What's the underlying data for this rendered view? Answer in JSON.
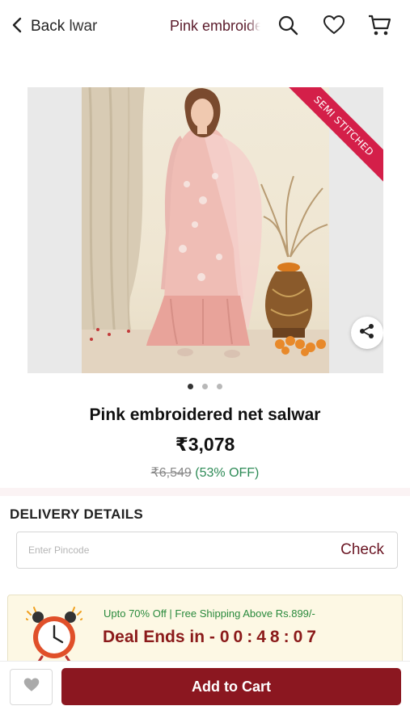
{
  "header": {
    "back_label": "Back",
    "back_overlap_text": "Pink embroidered net salwar",
    "title": "Pink embroidered net salwar",
    "icons": [
      "search-icon",
      "heart-icon",
      "cart-icon"
    ]
  },
  "gallery": {
    "badge": "SEMI STITCHED",
    "dots_count": 3,
    "active_dot": 0
  },
  "product": {
    "name": "Pink embroidered net salwar",
    "price": "₹3,078",
    "mrp": "₹6,549",
    "discount": "(53% OFF)"
  },
  "delivery": {
    "title": "DELIVERY DETAILS",
    "pincode_placeholder": "Enter Pincode",
    "check_label": "Check"
  },
  "deal": {
    "offer_text": "Upto 70% Off | Free Shipping Above Rs.899/-",
    "ends_label": "Deal Ends in -",
    "timer": "00:48:07"
  },
  "footer": {
    "add_to_cart_label": "Add to Cart"
  },
  "colors": {
    "accent": "#8b1720",
    "badge": "#d41f49",
    "discount": "#2e8b57"
  }
}
